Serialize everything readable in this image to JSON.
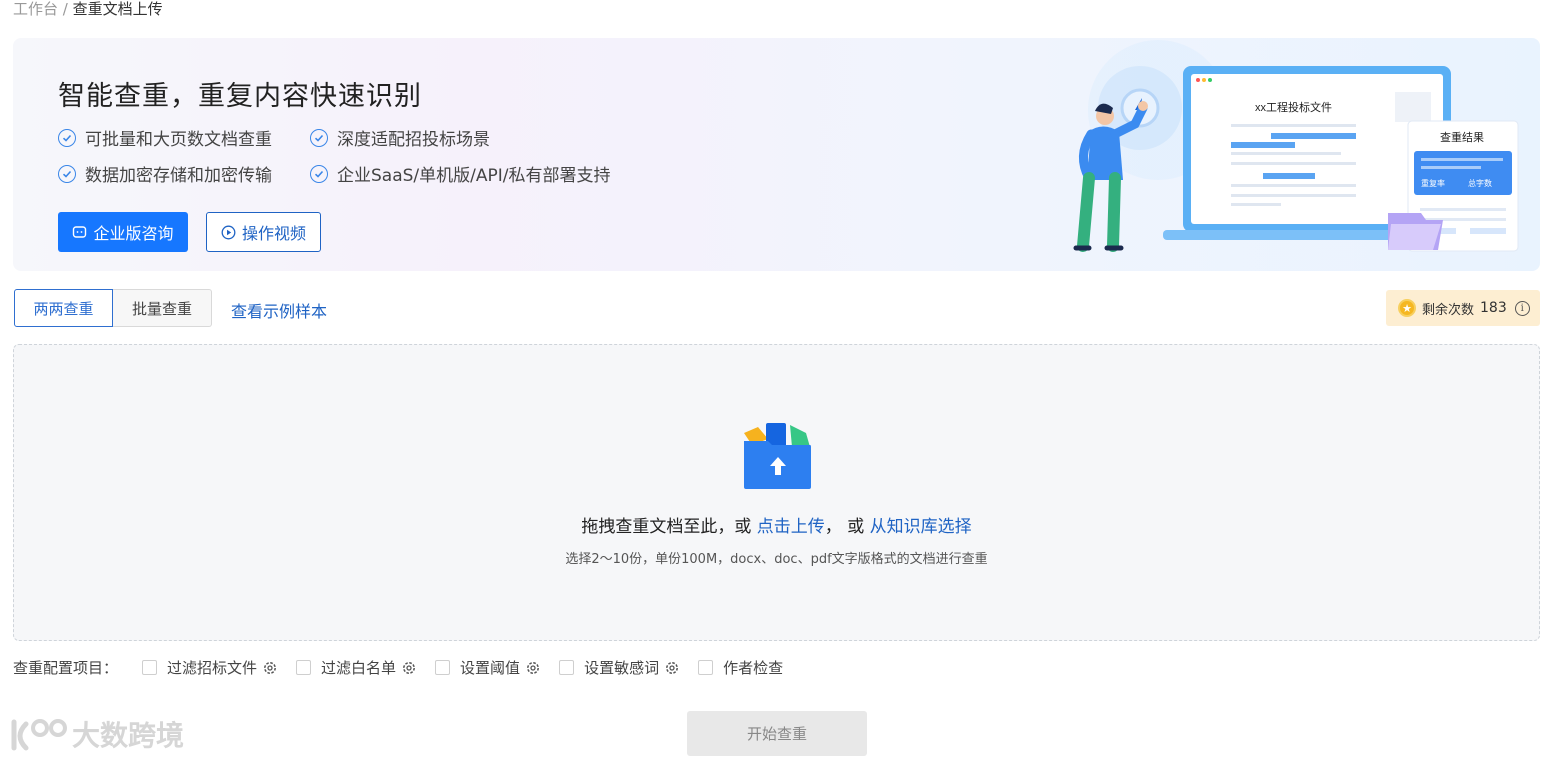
{
  "breadcrumb": {
    "root": "工作台",
    "separator": " / ",
    "current": "查重文档上传"
  },
  "banner": {
    "title": "智能查重，重复内容快速识别",
    "features": [
      "可批量和大页数文档查重",
      "深度适配招投标场景",
      "数据加密存储和加密传输",
      "企业SaaS/单机版/API/私有部署支持"
    ],
    "consult_button": "企业版咨询",
    "video_button": "操作视频",
    "illustration": {
      "doc_title": "xx工程投标文件",
      "result_title": "查重结果",
      "result_rate": "重复率",
      "result_words": "总字数"
    }
  },
  "tabs": [
    {
      "label": "两两查重",
      "active": true
    },
    {
      "label": "批量查重",
      "active": false
    }
  ],
  "sample_link": "查看示例样本",
  "remaining": {
    "label": "剩余次数",
    "count": "183"
  },
  "dropzone": {
    "text_prefix": "拖拽查重文档至此，或 ",
    "upload_link": "点击上传",
    "text_middle": "，  或 ",
    "library_link": "从知识库选择",
    "hint": "选择2～10份，单份100M，docx、doc、pdf文字版格式的文档进行查重"
  },
  "config": {
    "label": "查重配置项目：",
    "items": [
      {
        "label": "过滤招标文件",
        "has_settings": true,
        "checked": false
      },
      {
        "label": "过滤白名单",
        "has_settings": true,
        "checked": false
      },
      {
        "label": "设置阈值",
        "has_settings": true,
        "checked": false
      },
      {
        "label": "设置敏感词",
        "has_settings": true,
        "checked": false
      },
      {
        "label": "作者检查",
        "has_settings": false,
        "checked": false
      }
    ]
  },
  "start_button": "开始查重",
  "watermark": "大数跨境",
  "colors": {
    "primary": "#1677ff",
    "link": "#1f63c4",
    "remain_bg": "#fdeed2"
  }
}
